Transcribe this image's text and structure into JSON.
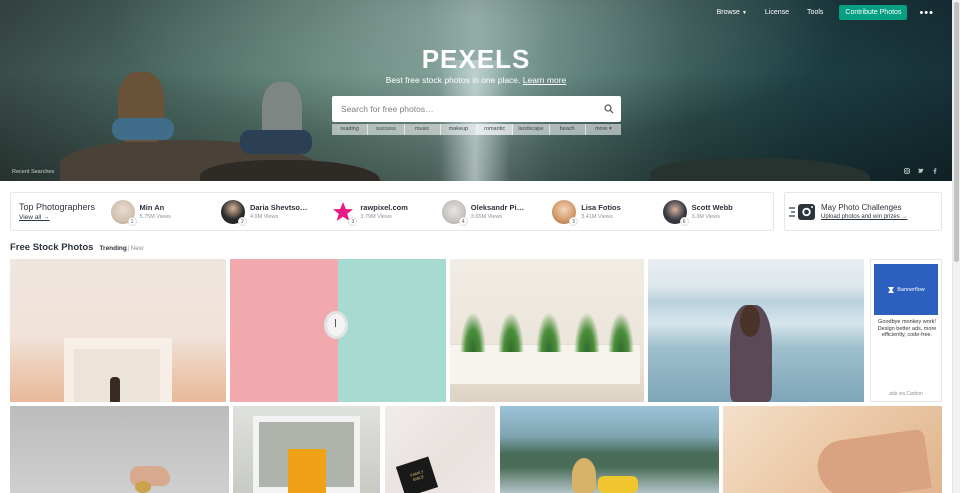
{
  "topnav": {
    "browse": "Browse",
    "license": "License",
    "tools": "Tools",
    "contribute": "Contribute Photos",
    "more": "•••",
    "contribute_color": "#05a081"
  },
  "hero": {
    "logo": "PEXELS",
    "tagline": "Best free stock photos in one place.",
    "learn_more": "Learn more",
    "search_placeholder": "Search for free photos…",
    "tags": [
      "reading",
      "success",
      "music",
      "makeup",
      "romantic",
      "landscape",
      "beach",
      "more"
    ],
    "recent_searches": "Recent Searches",
    "social_icons": [
      "instagram-icon",
      "twitter-icon",
      "facebook-icon"
    ]
  },
  "photographers": {
    "title": "Top Photographers",
    "view_all": "View all →",
    "items": [
      {
        "name": "Min An",
        "views": "5.75M Views",
        "rank": "1"
      },
      {
        "name": "Daria Shevtso…",
        "views": "4.9M Views",
        "rank": "2"
      },
      {
        "name": "rawpixel.com",
        "views": "3.79M Views",
        "rank": "3"
      },
      {
        "name": "Oleksandr Pi…",
        "views": "3.65M Views",
        "rank": "4"
      },
      {
        "name": "Lisa Fotios",
        "views": "3.41M Views",
        "rank": "5"
      },
      {
        "name": "Scott Webb",
        "views": "3.3M Views",
        "rank": "6"
      }
    ]
  },
  "challenge": {
    "title": "May Photo Challenges",
    "subtitle": "Upload photos and win prizes →"
  },
  "section": {
    "title": "Free Stock Photos",
    "trending": "Trending",
    "separator": "|",
    "new": "New"
  },
  "ad": {
    "brand": "Bannerflow",
    "text": "Goodbye monkey work! Design better ads, more efficiently, code-free.",
    "via": "ads via Carbon"
  },
  "photo_book_text": "FAMILY BIBLE"
}
